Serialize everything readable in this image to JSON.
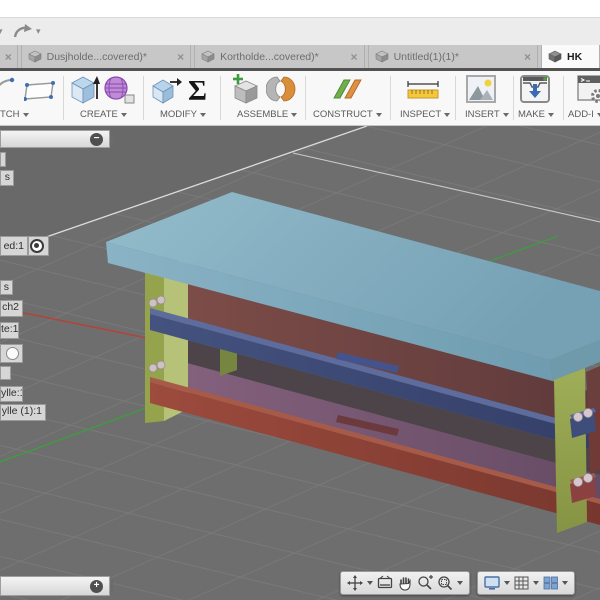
{
  "icons": {
    "close": "×",
    "minus": "−",
    "plus": "+",
    "caret": "▾",
    "sigma": "Σ"
  },
  "tabs": {
    "items": [
      {
        "label": "Dusjholde...covered)*"
      },
      {
        "label": "Kortholde...covered)*"
      },
      {
        "label": "Untitled(1)(1)*"
      },
      {
        "label": "HK"
      }
    ]
  },
  "ribbon": {
    "groups": [
      {
        "label": "TCH"
      },
      {
        "label": "CREATE"
      },
      {
        "label": "MODIFY"
      },
      {
        "label": "ASSEMBLE"
      },
      {
        "label": "CONSTRUCT"
      },
      {
        "label": "INSPECT"
      },
      {
        "label": "INSERT"
      },
      {
        "label": "MAKE"
      },
      {
        "label": "ADD-I"
      }
    ]
  },
  "browser": {
    "items": [
      {
        "label": ""
      },
      {
        "label": "s"
      },
      {
        "label": "ed:1"
      },
      {
        "label": "s"
      },
      {
        "label": "ch2"
      },
      {
        "label": "te:1"
      },
      {
        "label": ""
      },
      {
        "label": ""
      },
      {
        "label": "ylle:1"
      },
      {
        "label": "ylle (1):1"
      }
    ]
  },
  "model": {
    "background": "#6e6e6e",
    "top_color": "#84aebf",
    "shelf_mid_color": "#7c4a45",
    "shelf_low_color": "#7e5c80",
    "board_navy": "#3f4d7b",
    "board_red": "#8e4238",
    "leg_color": "#94a34c",
    "axis_x_color": "#b84034",
    "axis_y_color": "#3f9c3f"
  }
}
